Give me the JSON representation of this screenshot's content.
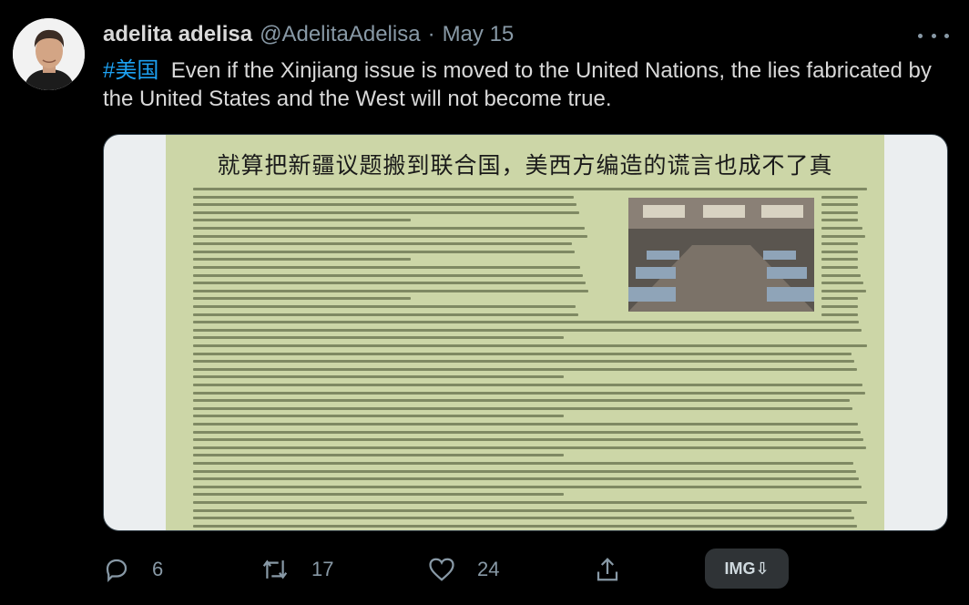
{
  "tweet": {
    "display_name": "adelita adelisa",
    "handle": "@AdelitaAdelisa",
    "separator": "·",
    "date": "May 15",
    "hashtag": "#美国",
    "body": "Even if the Xinjiang issue is moved to the United Nations, the lies fabricated by the United States and the West will not become true.",
    "media": {
      "title": "就算把新疆议题搬到联合国，美西方编造的谎言也成不了真"
    },
    "actions": {
      "reply_count": "6",
      "retweet_count": "17",
      "like_count": "24"
    },
    "img_button_label": "IMG⇩"
  },
  "colors": {
    "background": "#000000",
    "text": "#d9d9d9",
    "secondary": "#8899a6",
    "hashtag": "#1da1f2",
    "document_bg": "#ccd6a7"
  }
}
